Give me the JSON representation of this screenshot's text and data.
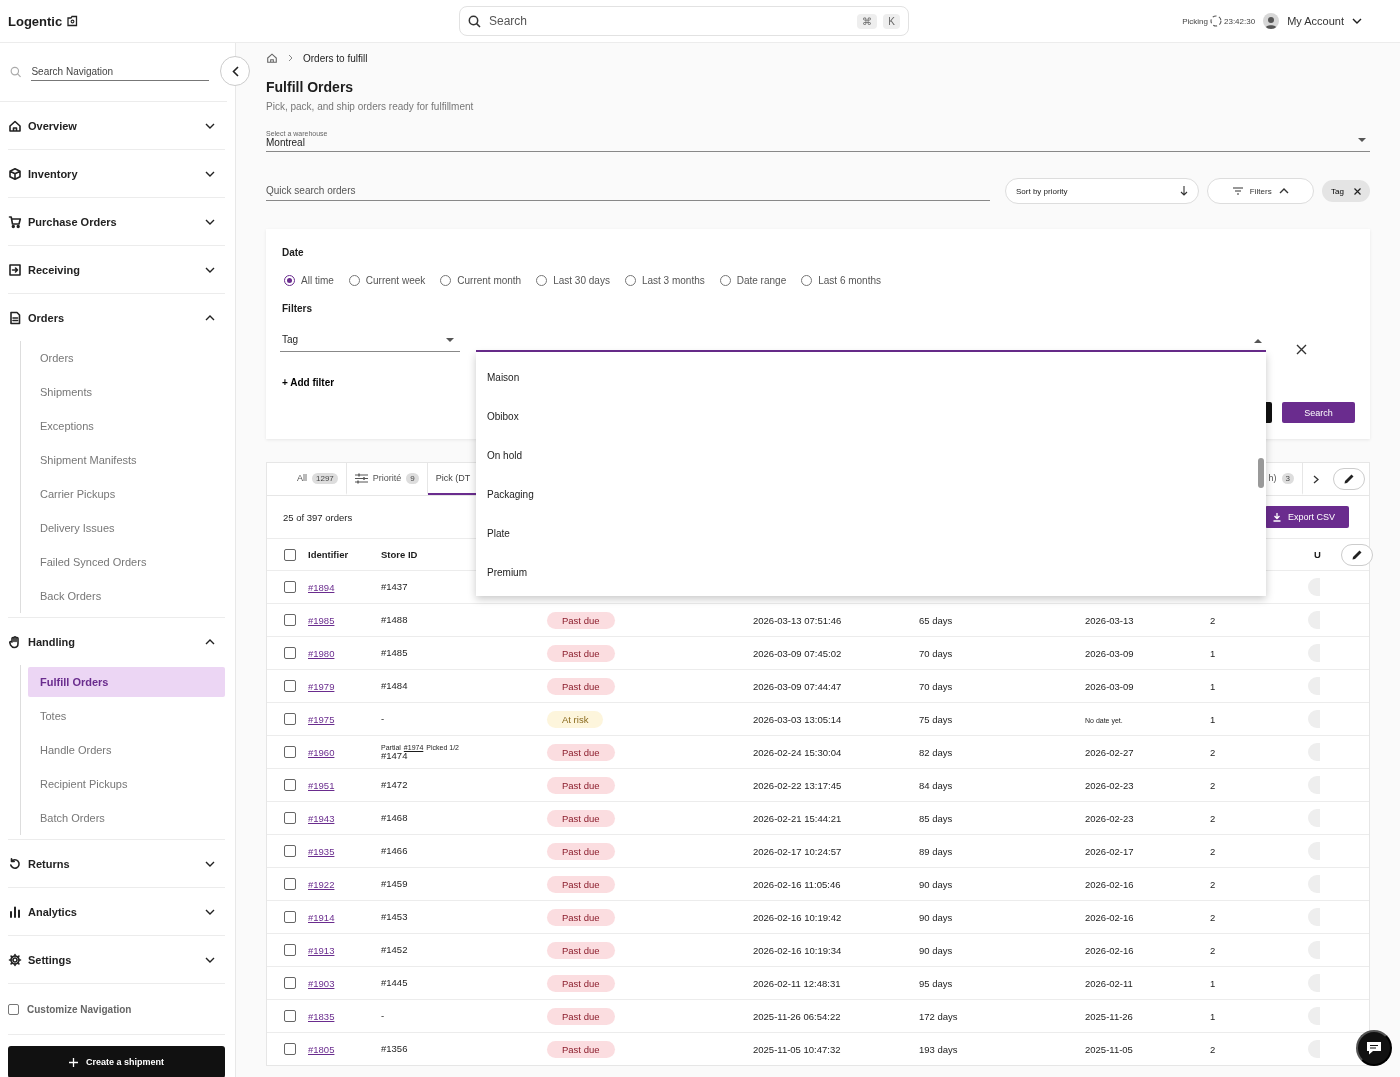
{
  "header": {
    "logo": "Logentic",
    "search": {
      "placeholder": "Search",
      "keys": [
        "⌘",
        "K"
      ]
    },
    "timer": {
      "label": "Picking",
      "time": "23:42:30"
    },
    "account": "My Account"
  },
  "sidebar": {
    "search": {
      "placeholder": "Search Navigation"
    },
    "sections": [
      {
        "label": "Overview",
        "kind": "home",
        "expanded": false
      },
      {
        "label": "Inventory",
        "kind": "box",
        "expanded": false
      },
      {
        "label": "Purchase Orders",
        "kind": "cart",
        "expanded": false
      },
      {
        "label": "Receiving",
        "kind": "receive",
        "expanded": false
      },
      {
        "label": "Orders",
        "kind": "doc",
        "expanded": true,
        "items": [
          {
            "label": "Orders",
            "selected": false
          },
          {
            "label": "Shipments",
            "selected": false
          },
          {
            "label": "Exceptions",
            "selected": false
          },
          {
            "label": "Shipment Manifests",
            "selected": false
          },
          {
            "label": "Carrier Pickups",
            "selected": false
          },
          {
            "label": "Delivery Issues",
            "selected": false
          },
          {
            "label": "Failed Synced Orders",
            "selected": false
          },
          {
            "label": "Back Orders",
            "selected": false
          }
        ]
      },
      {
        "label": "Handling",
        "kind": "hand",
        "expanded": true,
        "items": [
          {
            "label": "Fulfill Orders",
            "selected": true
          },
          {
            "label": "Totes",
            "selected": false
          },
          {
            "label": "Handle Orders",
            "selected": false
          },
          {
            "label": "Recipient Pickups",
            "selected": false
          },
          {
            "label": "Batch Orders",
            "selected": false
          }
        ]
      },
      {
        "label": "Returns",
        "kind": "return",
        "expanded": false
      },
      {
        "label": "Analytics",
        "kind": "chart",
        "expanded": false
      },
      {
        "label": "Settings",
        "kind": "gear",
        "expanded": false
      }
    ],
    "customize": {
      "label": "Customize Navigation",
      "checked": false
    },
    "create_button": "Create a shipment"
  },
  "breadcrumb": [
    "Orders to fulfill"
  ],
  "page": {
    "title": "Fulfill Orders",
    "subtitle": "Pick, pack, and ship orders ready for fulfillment"
  },
  "warehouse": {
    "label": "Select a warehouse",
    "value": "Montreal"
  },
  "toolbar": {
    "search_placeholder": "Quick search orders",
    "sort": "Sort by priority",
    "filters": {
      "label": "Filters",
      "expanded": true
    },
    "chips": [
      "Tag"
    ]
  },
  "filter_panel": {
    "date_label": "Date",
    "date_options": [
      {
        "label": "All time",
        "selected": true
      },
      {
        "label": "Current week",
        "selected": false
      },
      {
        "label": "Current month",
        "selected": false
      },
      {
        "label": "Last 30 days",
        "selected": false
      },
      {
        "label": "Last 3 months",
        "selected": false
      },
      {
        "label": "Date range",
        "selected": false
      },
      {
        "label": "Last 6 months",
        "selected": false
      }
    ],
    "filters_label": "Filters",
    "filter_field": "Tag",
    "add_filter": "+ Add filter",
    "search_button": "Search",
    "dropdown": [
      "Maison",
      "Obibox",
      "On hold",
      "Packaging",
      "Plate",
      "Premium"
    ]
  },
  "tabs": [
    {
      "label": "All",
      "count": "1297",
      "kind": "plain",
      "selected": false
    },
    {
      "label": "Priorité",
      "count": "9",
      "kind": "filtered",
      "selected": false
    },
    {
      "label": "Pick (DT",
      "kind": "plain",
      "selected": true
    },
    {
      "label": "h)",
      "count": "3",
      "kind": "plain",
      "selected": false
    }
  ],
  "orders": {
    "summary": "25 of 397 orders",
    "export": "Export CSV",
    "columns": [
      "Identifier",
      "Store ID",
      "U"
    ],
    "select_all_checked": false,
    "rows": [
      {
        "checked": false,
        "identifier": "#1894",
        "store_id": "#1437"
      },
      {
        "checked": false,
        "identifier": "#1985",
        "store_id": "#1488",
        "column_3": {
          "label": "Past due",
          "kind": "past_due"
        },
        "column_4": "2026-03-13 07:51:46",
        "column_5": "65 days",
        "column_6": "2026-03-13",
        "column_7": "2"
      },
      {
        "checked": false,
        "identifier": "#1980",
        "store_id": "#1485",
        "column_3": {
          "label": "Past due",
          "kind": "past_due"
        },
        "column_4": "2026-03-09 07:45:02",
        "column_5": "70 days",
        "column_6": "2026-03-09",
        "column_7": "1"
      },
      {
        "checked": false,
        "identifier": "#1979",
        "store_id": "#1484",
        "column_3": {
          "label": "Past due",
          "kind": "past_due"
        },
        "column_4": "2026-03-09 07:44:47",
        "column_5": "70 days",
        "column_6": "2026-03-09",
        "column_7": "1"
      },
      {
        "checked": false,
        "identifier": "#1975",
        "store_id": "-",
        "column_3": {
          "label": "At risk",
          "kind": "at_risk"
        },
        "column_4": "2026-03-03 13:05:14",
        "column_5": "75 days",
        "column_6_note": "No date yet.",
        "column_7": "1"
      },
      {
        "checked": false,
        "identifier": "#1960",
        "store_id": "#1474",
        "partial": {
          "label": "Partial",
          "link": "#1974",
          "status": "Picked 1/2"
        },
        "column_3": {
          "label": "Past due",
          "kind": "past_due"
        },
        "column_4": "2026-02-24 15:30:04",
        "column_5": "82 days",
        "column_6": "2026-02-27",
        "column_7": "2"
      },
      {
        "checked": false,
        "identifier": "#1951",
        "store_id": "#1472",
        "column_3": {
          "label": "Past due",
          "kind": "past_due"
        },
        "column_4": "2026-02-22 13:17:45",
        "column_5": "84 days",
        "column_6": "2026-02-23",
        "column_7": "2"
      },
      {
        "checked": false,
        "identifier": "#1943",
        "store_id": "#1468",
        "column_3": {
          "label": "Past due",
          "kind": "past_due"
        },
        "column_4": "2026-02-21 15:44:21",
        "column_5": "85 days",
        "column_6": "2026-02-23",
        "column_7": "2"
      },
      {
        "checked": false,
        "identifier": "#1935",
        "store_id": "#1466",
        "column_3": {
          "label": "Past due",
          "kind": "past_due"
        },
        "column_4": "2026-02-17 10:24:57",
        "column_5": "89 days",
        "column_6": "2026-02-17",
        "column_7": "2"
      },
      {
        "checked": false,
        "identifier": "#1922",
        "store_id": "#1459",
        "column_3": {
          "label": "Past due",
          "kind": "past_due"
        },
        "column_4": "2026-02-16 11:05:46",
        "column_5": "90 days",
        "column_6": "2026-02-16",
        "column_7": "2"
      },
      {
        "checked": false,
        "identifier": "#1914",
        "store_id": "#1453",
        "column_3": {
          "label": "Past due",
          "kind": "past_due"
        },
        "column_4": "2026-02-16 10:19:42",
        "column_5": "90 days",
        "column_6": "2026-02-16",
        "column_7": "2"
      },
      {
        "checked": false,
        "identifier": "#1913",
        "store_id": "#1452",
        "column_3": {
          "label": "Past due",
          "kind": "past_due"
        },
        "column_4": "2026-02-16 10:19:34",
        "column_5": "90 days",
        "column_6": "2026-02-16",
        "column_7": "2"
      },
      {
        "checked": false,
        "identifier": "#1903",
        "store_id": "#1445",
        "column_3": {
          "label": "Past due",
          "kind": "past_due"
        },
        "column_4": "2026-02-11 12:48:31",
        "column_5": "95 days",
        "column_6": "2026-02-11",
        "column_7": "1"
      },
      {
        "checked": false,
        "identifier": "#1835",
        "store_id": "-",
        "column_3": {
          "label": "Past due",
          "kind": "past_due"
        },
        "column_4": "2025-11-26 06:54:22",
        "column_5": "172 days",
        "column_6": "2025-11-26",
        "column_7": "1"
      },
      {
        "checked": false,
        "identifier": "#1805",
        "store_id": "#1356",
        "column_3": {
          "label": "Past due",
          "kind": "past_due"
        },
        "column_4": "2025-11-05 10:47:32",
        "column_5": "193 days",
        "column_6": "2025-11-05",
        "column_7": "2"
      }
    ]
  }
}
